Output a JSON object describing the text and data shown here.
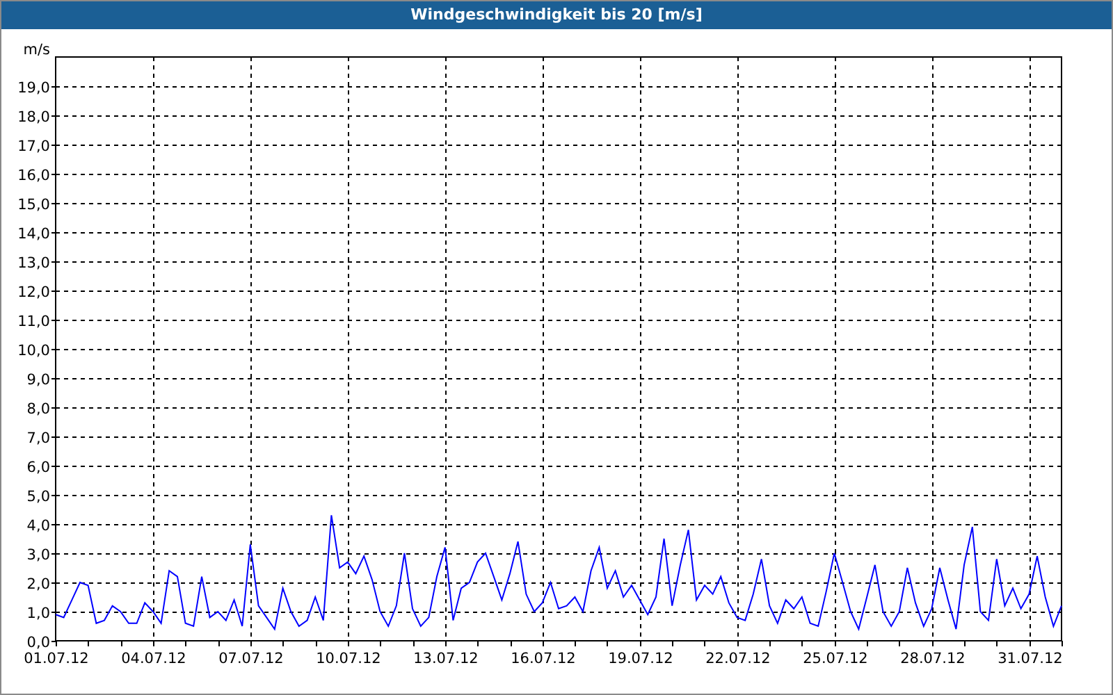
{
  "chart_data": {
    "type": "line",
    "title": "Windgeschwindigkeit bis 20 [m/s]",
    "ylabel": "m/s",
    "grid": true,
    "ylim": [
      0,
      20
    ],
    "categories": [
      "01.07.12",
      null,
      null,
      null,
      null,
      null,
      null,
      null,
      null,
      null,
      null,
      null,
      "04.07.12",
      null,
      null,
      null,
      null,
      null,
      null,
      null,
      null,
      null,
      null,
      null,
      "07.07.12",
      null,
      null,
      null,
      null,
      null,
      null,
      null,
      null,
      null,
      null,
      null,
      "10.07.12",
      null,
      null,
      null,
      null,
      null,
      null,
      null,
      null,
      null,
      null,
      null,
      "13.07.12",
      null,
      null,
      null,
      null,
      null,
      null,
      null,
      null,
      null,
      null,
      null,
      "16.07.12",
      null,
      null,
      null,
      null,
      null,
      null,
      null,
      null,
      null,
      null,
      null,
      "19.07.12",
      null,
      null,
      null,
      null,
      null,
      null,
      null,
      null,
      null,
      null,
      null,
      "22.07.12",
      null,
      null,
      null,
      null,
      null,
      null,
      null,
      null,
      null,
      null,
      null,
      "25.07.12",
      null,
      null,
      null,
      null,
      null,
      null,
      null,
      null,
      null,
      null,
      null,
      "28.07.12",
      null,
      null,
      null,
      null,
      null,
      null,
      null,
      null,
      null,
      null,
      null,
      "31.07.12",
      null,
      null,
      null,
      null
    ],
    "yticks": [
      {
        "value": 0,
        "label": "0,0"
      },
      {
        "value": 1,
        "label": "1,0"
      },
      {
        "value": 2,
        "label": "2,0"
      },
      {
        "value": 3,
        "label": "3,0"
      },
      {
        "value": 4,
        "label": "4,0"
      },
      {
        "value": 5,
        "label": "5,0"
      },
      {
        "value": 6,
        "label": "6,0"
      },
      {
        "value": 7,
        "label": "7,0"
      },
      {
        "value": 8,
        "label": "8,0"
      },
      {
        "value": 9,
        "label": "9,0"
      },
      {
        "value": 10,
        "label": "10,0"
      },
      {
        "value": 11,
        "label": "11,0"
      },
      {
        "value": 12,
        "label": "12,0"
      },
      {
        "value": 13,
        "label": "13,0"
      },
      {
        "value": 14,
        "label": "14,0"
      },
      {
        "value": 15,
        "label": "15,0"
      },
      {
        "value": 16,
        "label": "16,0"
      },
      {
        "value": 17,
        "label": "17,0"
      },
      {
        "value": 18,
        "label": "18,0"
      },
      {
        "value": 19,
        "label": "19,0"
      }
    ],
    "series": [
      {
        "color": "#0000ff",
        "values": [
          0.9,
          0.8,
          1.4,
          2.0,
          1.9,
          0.6,
          0.7,
          1.2,
          1.0,
          0.6,
          0.6,
          1.3,
          1.0,
          0.6,
          2.4,
          2.2,
          0.6,
          0.5,
          2.2,
          0.8,
          1.0,
          0.7,
          1.4,
          0.5,
          3.3,
          1.2,
          0.8,
          0.4,
          1.8,
          1.0,
          0.5,
          0.7,
          1.5,
          0.7,
          4.3,
          2.5,
          2.7,
          2.3,
          2.9,
          2.1,
          1.0,
          0.5,
          1.2,
          3.0,
          1.1,
          0.5,
          0.8,
          2.2,
          3.2,
          0.7,
          1.8,
          2.0,
          2.7,
          3.0,
          2.2,
          1.4,
          2.3,
          3.4,
          1.6,
          1.0,
          1.3,
          2.0,
          1.1,
          1.2,
          1.5,
          1.0,
          2.4,
          3.2,
          1.8,
          2.4,
          1.5,
          1.9,
          1.4,
          0.9,
          1.5,
          3.5,
          1.2,
          2.6,
          3.8,
          1.4,
          1.9,
          1.6,
          2.2,
          1.3,
          0.8,
          0.7,
          1.6,
          2.8,
          1.2,
          0.6,
          1.4,
          1.1,
          1.5,
          0.6,
          0.5,
          1.7,
          3.0,
          2.0,
          1.0,
          0.4,
          1.5,
          2.6,
          1.0,
          0.5,
          1.0,
          2.5,
          1.3,
          0.5,
          1.1,
          2.5,
          1.4,
          0.4,
          2.6,
          3.9,
          1.0,
          0.7,
          2.8,
          1.2,
          1.8,
          1.1,
          1.6,
          2.9,
          1.5,
          0.5,
          1.2
        ]
      }
    ]
  }
}
